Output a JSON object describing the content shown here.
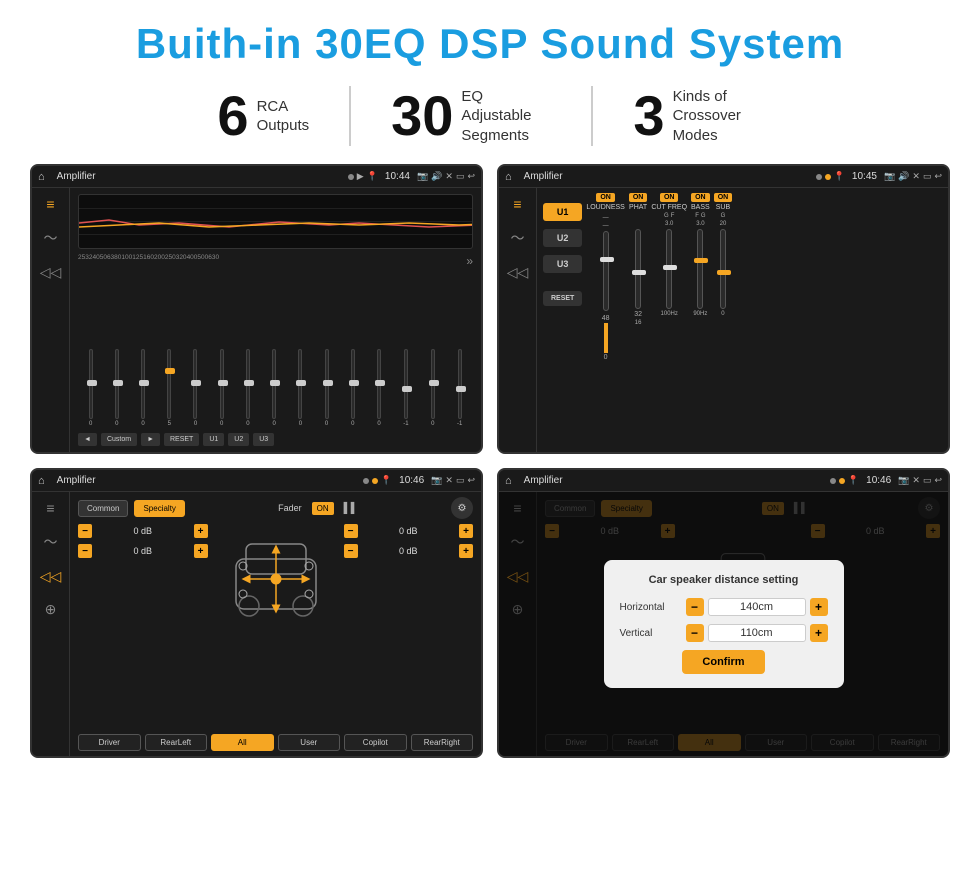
{
  "header": {
    "title": "Buith-in 30EQ DSP Sound System"
  },
  "stats": [
    {
      "number": "6",
      "label": "RCA\nOutputs"
    },
    {
      "number": "30",
      "label": "EQ Adjustable\nSegments"
    },
    {
      "number": "3",
      "label": "Kinds of\nCrossover Modes"
    }
  ],
  "screens": {
    "eq": {
      "topbar": {
        "title": "Amplifier",
        "time": "10:44"
      },
      "frequencies": [
        "25",
        "32",
        "40",
        "50",
        "63",
        "80",
        "100",
        "125",
        "160",
        "200",
        "250",
        "320",
        "400",
        "500",
        "630"
      ],
      "values": [
        "0",
        "0",
        "0",
        "5",
        "0",
        "0",
        "0",
        "0",
        "0",
        "0",
        "0",
        "0",
        "-1",
        "0",
        "-1"
      ],
      "buttons": [
        "◄",
        "Custom",
        "►",
        "RESET",
        "U1",
        "U2",
        "U3"
      ]
    },
    "crossover": {
      "topbar": {
        "title": "Amplifier",
        "time": "10:45"
      },
      "uButtons": [
        "U1",
        "U2",
        "U3"
      ],
      "controls": [
        {
          "label": "LOUDNESS",
          "on": true
        },
        {
          "label": "PHAT",
          "on": true
        },
        {
          "label": "CUT FREQ",
          "on": true
        },
        {
          "label": "BASS",
          "on": true
        },
        {
          "label": "SUB",
          "on": true
        }
      ],
      "resetLabel": "RESET"
    },
    "fader": {
      "topbar": {
        "title": "Amplifier",
        "time": "10:46"
      },
      "tabs": [
        "Common",
        "Specialty"
      ],
      "activeTab": "Specialty",
      "faderLabel": "Fader",
      "onToggle": "ON",
      "volumes": [
        "0 dB",
        "0 dB",
        "0 dB",
        "0 dB"
      ],
      "bottomButtons": [
        "Driver",
        "RearLeft",
        "All",
        "User",
        "Copilot",
        "RearRight"
      ]
    },
    "faderModal": {
      "topbar": {
        "title": "Amplifier",
        "time": "10:46"
      },
      "tabs": [
        "Common",
        "Specialty"
      ],
      "activeTab": "Specialty",
      "onToggle": "ON",
      "volumes": [
        "0 dB",
        "0 dB"
      ],
      "modal": {
        "title": "Car speaker distance setting",
        "horizontal": {
          "label": "Horizontal",
          "value": "140cm"
        },
        "vertical": {
          "label": "Vertical",
          "value": "110cm"
        },
        "confirmLabel": "Confirm"
      },
      "bottomButtons": [
        "Driver",
        "RearLeft",
        "All",
        "User",
        "Copilot",
        "RearRight"
      ]
    }
  },
  "colors": {
    "accent": "#f5a623",
    "background": "#1a1a1a",
    "blue_title": "#1a9de0"
  }
}
